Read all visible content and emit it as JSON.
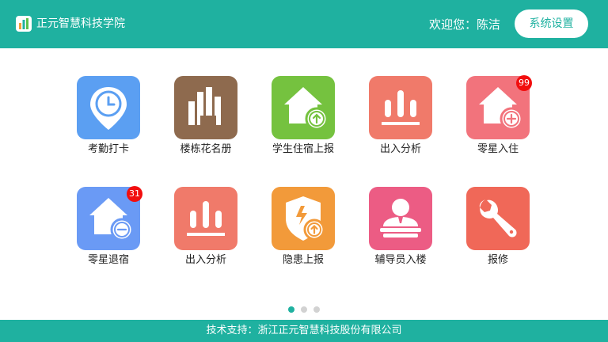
{
  "header": {
    "app_title": "正元智慧科技学院",
    "welcome": "欢迎您：陈洁",
    "settings_label": "系统设置",
    "bg_color": "#1fb1a0"
  },
  "tiles": [
    {
      "label": "考勤打卡",
      "icon": "location-clock-icon",
      "color": "#5b9ff2"
    },
    {
      "label": "楼栋花名册",
      "icon": "building-icon",
      "color": "#8e6a4e"
    },
    {
      "label": "学生住宿上报",
      "icon": "home-upload-icon",
      "color": "#75c23f"
    },
    {
      "label": "出入分析",
      "icon": "bar-chart-icon",
      "color": "#f07a6a"
    },
    {
      "label": "零星入住",
      "icon": "home-add-icon",
      "color": "#f2737c",
      "badge": "99"
    },
    {
      "label": "零星退宿",
      "icon": "home-remove-icon",
      "color": "#6a9af5",
      "badge": "31"
    },
    {
      "label": "出入分析",
      "icon": "bar-chart-icon",
      "color": "#f07a6a"
    },
    {
      "label": "隐患上报",
      "icon": "shield-upload-icon",
      "color": "#f29a3a"
    },
    {
      "label": "辅导员入楼",
      "icon": "counselor-icon",
      "color": "#ec5c84"
    },
    {
      "label": "报修",
      "icon": "wrench-icon",
      "color": "#f06858"
    }
  ],
  "pager": {
    "count": 3,
    "active": 0,
    "active_color": "#1fb1a0"
  },
  "footer": {
    "text": "技术支持：浙江正元智慧科技股份有限公司"
  }
}
